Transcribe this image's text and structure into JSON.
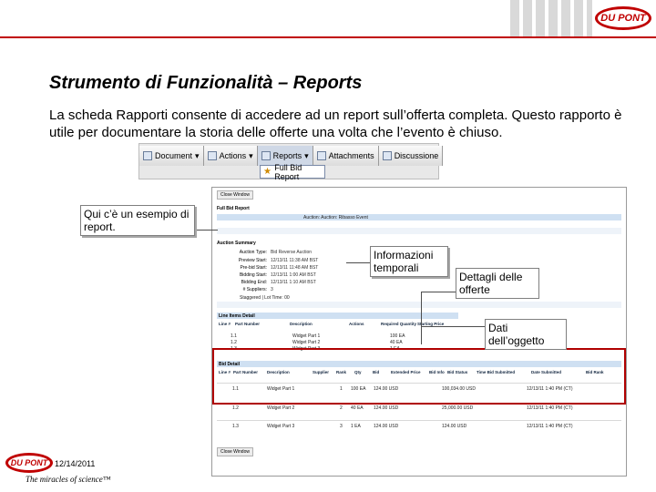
{
  "header": {
    "logo_text": "DU PONT",
    "accent_color": "#c00000"
  },
  "slide": {
    "title": "Strumento di Funzionalità – Reports",
    "body": "La scheda Rapporti consente di accedere ad un report sull’offerta completa. Questo rapporto è utile per documentare la storia delle offerte una volta che l’evento è chiuso."
  },
  "toolbar": {
    "items": [
      {
        "label": "Document",
        "icon": "document-icon"
      },
      {
        "label": "Actions",
        "icon": "actions-icon"
      },
      {
        "label": "Reports",
        "icon": "reports-icon"
      },
      {
        "label": "Attachments",
        "icon": "attachment-icon"
      },
      {
        "label": "Discussione",
        "icon": "discussion-icon"
      }
    ],
    "menu_item": "Full Bid Report"
  },
  "report": {
    "close_window": "Close Window",
    "section_title": "Full Bid Report",
    "auction_bar": "Auction: Auction: Ribasso Event",
    "auction_summary": "Auction Summary",
    "summary": [
      {
        "label": "Auction Type:",
        "value": "Bid Reverse Auction"
      },
      {
        "label": "Preview Start:",
        "value": "12/13/11 11:38 AM BST"
      },
      {
        "label": "Pre-bid Start:",
        "value": "12/13/11 11:48 AM BST"
      },
      {
        "label": "Bidding Start:",
        "value": "12/13/11 1:00 AM BST"
      },
      {
        "label": "Bidding End:",
        "value": "12/13/11 1:10 AM BST"
      },
      {
        "label": "# Suppliers:",
        "value": "3"
      }
    ],
    "staggered": "Staggered | Lot Time: 00",
    "lines_title": "Line Items Detail",
    "line_headers": [
      "Line #",
      "Part Number",
      "Description",
      "Actions",
      "Required Quantity",
      "Starting Price"
    ],
    "line_rows": [
      {
        "line": "1.1",
        "desc": "Widget Part 1",
        "qty": "100 EA"
      },
      {
        "line": "1.2",
        "desc": "Widget Part 2",
        "qty": "40 EA"
      },
      {
        "line": "1.3",
        "desc": "Widget Part 3",
        "qty": "1 EA"
      }
    ],
    "bid_title": "Bid Detail",
    "bid_headers": [
      "Line #",
      "Part Number",
      "Description",
      "Supplier",
      "Rank",
      "Qty",
      "Bid",
      "Extended Price",
      "Bid Info",
      "Bid Status",
      "Time Bid Submitted",
      "Date Submitted",
      "Bid Rank"
    ],
    "bid_rows": [
      {
        "line": "1.1",
        "desc": "Widget Part 1",
        "qty": "1",
        "unit": "100 EA",
        "price": "124.00 USD",
        "ext": "100,034.00 USD",
        "time": "12/13/11 1:40 PM (CT)"
      },
      {
        "line": "1.2",
        "desc": "Widget Part 2",
        "qty": "2",
        "unit": "40 EA",
        "price": "124.00 USD",
        "ext": "25,000.00 USD",
        "time": "12/13/11 1:40 PM (CT)"
      },
      {
        "line": "1.3",
        "desc": "Widget Part 3",
        "qty": "3",
        "unit": "1 EA",
        "price": "124.00 USD",
        "ext": "124.00 USD",
        "time": "12/13/11 1:40 PM (CT)"
      }
    ]
  },
  "callouts": {
    "example": "Qui c’è un esempio di report.",
    "time_info": "Informazioni temporali",
    "bid_details": "Dettagli delle offerte",
    "item_data": "Dati dell’oggetto"
  },
  "footer": {
    "date": "12/14/2011",
    "logo_text": "DU PONT",
    "tagline": "The miracles of science™"
  }
}
